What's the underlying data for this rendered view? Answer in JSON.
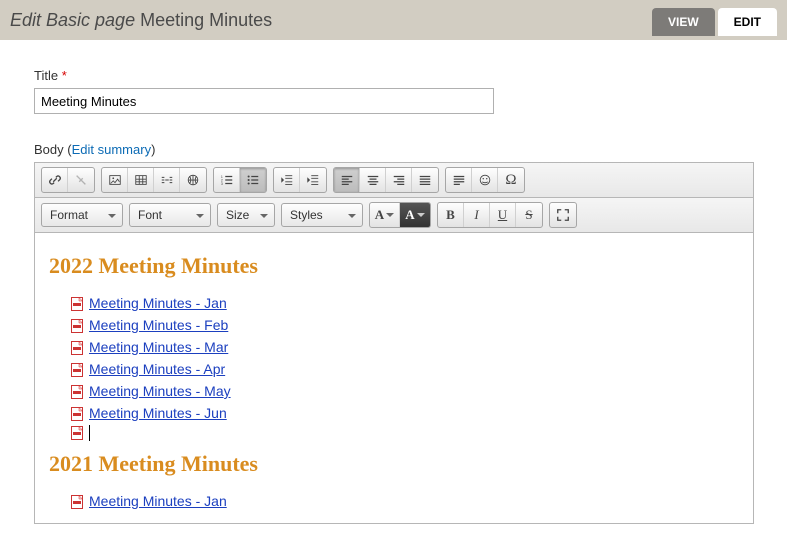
{
  "header": {
    "prefix": "Edit Basic page",
    "title": "Meeting Minutes"
  },
  "tabs": {
    "view": "VIEW",
    "edit": "EDIT"
  },
  "title_field": {
    "label": "Title",
    "required_marker": "*",
    "value": "Meeting Minutes"
  },
  "body_field": {
    "label": "Body",
    "summary_pre": "(",
    "summary_link": "Edit summary",
    "summary_post": ")"
  },
  "toolbar": {
    "format": "Format",
    "font": "Font",
    "size": "Size",
    "styles": "Styles",
    "letter_a": "A",
    "bold": "B",
    "italic": "I",
    "underline": "U",
    "strike": "S"
  },
  "content": {
    "sections": [
      {
        "heading": "2022 Meeting Minutes",
        "items": [
          "Meeting Minutes - Jan",
          "Meeting Minutes - Feb",
          "Meeting Minutes - Mar",
          "Meeting Minutes - Apr",
          "Meeting Minutes - May",
          "Meeting Minutes - Jun"
        ],
        "has_empty_cursor_row": true
      },
      {
        "heading": "2021 Meeting Minutes",
        "items": [
          "Meeting Minutes - Jan"
        ],
        "has_empty_cursor_row": false
      }
    ]
  }
}
